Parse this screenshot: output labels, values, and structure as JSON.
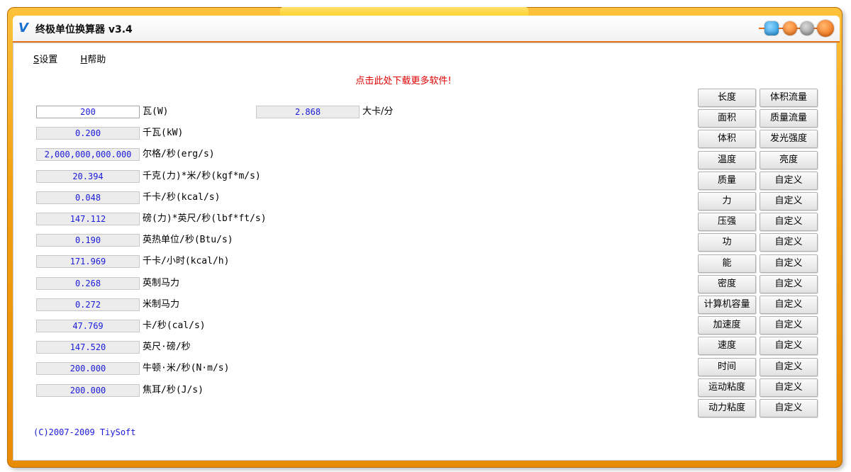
{
  "window": {
    "title": "终极单位换算器 v3.4",
    "icon": "app-logo-icon"
  },
  "menu": [
    {
      "accel": "S",
      "label": "设置"
    },
    {
      "accel": "H",
      "label": "帮助"
    }
  ],
  "promo": "点击此处下载更多软件!",
  "conversions": [
    {
      "value": "200",
      "unit": "瓦(W)",
      "active": true
    },
    {
      "value": "0.200",
      "unit": "千瓦(kW)"
    },
    {
      "value": "2,000,000,000.000",
      "unit": "尔格/秒(erg/s)"
    },
    {
      "value": "20.394",
      "unit": "千克(力)*米/秒(kgf*m/s)"
    },
    {
      "value": "0.048",
      "unit": "千卡/秒(kcal/s)"
    },
    {
      "value": "147.112",
      "unit": "磅(力)*英尺/秒(lbf*ft/s)"
    },
    {
      "value": "0.190",
      "unit": "英热单位/秒(Btu/s)"
    },
    {
      "value": "171.969",
      "unit": "千卡/小时(kcal/h)"
    },
    {
      "value": "0.268",
      "unit": "英制马力"
    },
    {
      "value": "0.272",
      "unit": "米制马力"
    },
    {
      "value": "47.769",
      "unit": "卡/秒(cal/s)"
    },
    {
      "value": "147.520",
      "unit": "英尺·磅/秒"
    },
    {
      "value": "200.000",
      "unit": "牛顿·米/秒(N·m/s)"
    },
    {
      "value": "200.000",
      "unit": "焦耳/秒(J/s)"
    }
  ],
  "result": {
    "value": "2.868",
    "unit": "大卡/分"
  },
  "categories_left": [
    "长度",
    "面积",
    "体积",
    "温度",
    "质量",
    "力",
    "压强",
    "功",
    "能",
    "密度",
    "计算机容量",
    "加速度",
    "速度",
    "时间",
    "运动粘度",
    "动力粘度"
  ],
  "categories_right": [
    "体积流量",
    "质量流量",
    "发光强度",
    "亮度",
    "自定义",
    "自定义",
    "自定义",
    "自定义",
    "自定义",
    "自定义",
    "自定义",
    "自定义",
    "自定义",
    "自定义",
    "自定义",
    "自定义"
  ],
  "copyright": "(C)2007-2009 TiySoft"
}
